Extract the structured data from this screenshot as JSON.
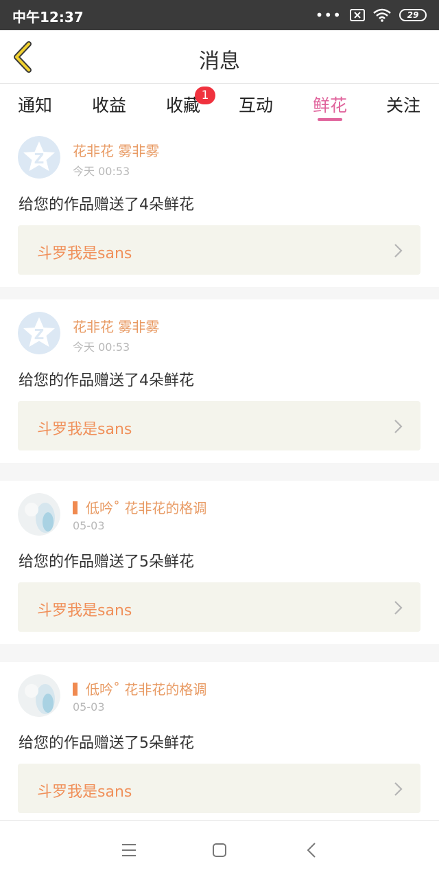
{
  "status_bar": {
    "time": "中午12:37",
    "dots": "•••",
    "battery": "29"
  },
  "header": {
    "title": "消息"
  },
  "tabs": [
    {
      "label": "通知"
    },
    {
      "label": "收益"
    },
    {
      "label": "收藏",
      "badge": "1"
    },
    {
      "label": "互动"
    },
    {
      "label": "鲜花",
      "active": true
    },
    {
      "label": "关注"
    }
  ],
  "messages": [
    {
      "sender": "花非花 雾非雾",
      "time": "今天 00:53",
      "text": "给您的作品赠送了4朵鲜花",
      "work": "斗罗我是sans",
      "avatar": "star-avatar-icon"
    },
    {
      "sender": "花非花 雾非雾",
      "time": "今天 00:53",
      "text": "给您的作品赠送了4朵鲜花",
      "work": "斗罗我是sans",
      "avatar": "star-avatar-icon"
    },
    {
      "sender": "低吟˚ 花非花的格调",
      "time": "05-03",
      "text": "给您的作品赠送了5朵鲜花",
      "work": "斗罗我是sans",
      "avatar": "photo-avatar"
    },
    {
      "sender": "低吟˚ 花非花的格调",
      "time": "05-03",
      "text": "给您的作品赠送了5朵鲜花",
      "work": "斗罗我是sans",
      "avatar": "photo-avatar"
    }
  ],
  "colors": {
    "accent_pink": "#e0649c",
    "sender_orange": "#e89a63",
    "work_orange": "#f0905a",
    "badge_red": "#f0323e",
    "back_arrow_yellow": "#f2d230"
  }
}
